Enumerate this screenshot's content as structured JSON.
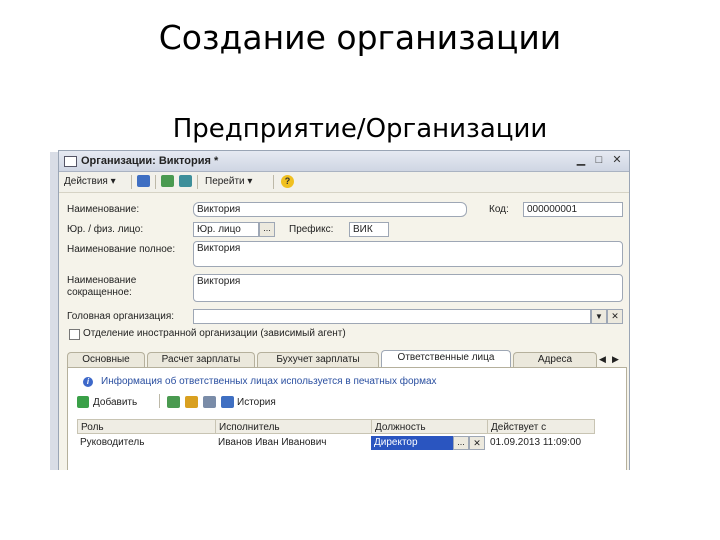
{
  "slide": {
    "title": "Создание организации",
    "subtitle": "Предприятие/Организации"
  },
  "window": {
    "title": "Организации: Виктория *",
    "minimize": "▁",
    "maximize": "□",
    "close": "✕"
  },
  "toolbar": {
    "actions_label": "Действия ▾",
    "goto_label": "Перейти ▾",
    "help_label": "?"
  },
  "form": {
    "name_label": "Наименование:",
    "name_value": "Виктория",
    "code_label": "Код:",
    "code_value": "000000001",
    "legal_label": "Юр. / физ. лицо:",
    "legal_value": "Юр. лицо",
    "prefix_label": "Префикс:",
    "prefix_value": "ВИК",
    "fullname_label": "Наименование полное:",
    "fullname_value": "Виктория",
    "shortname_label_1": "Наименование",
    "shortname_label_2": "сокращенное:",
    "shortname_value": "Виктория",
    "head_org_label": "Головная организация:",
    "head_org_value": "",
    "branch_label": "Отделение иностранной организации (зависимый агент)"
  },
  "tabs": [
    {
      "label": "Основные"
    },
    {
      "label": "Расчет зарплаты"
    },
    {
      "label": "Бухучет зарплаты"
    },
    {
      "label": "Ответственные лица"
    },
    {
      "label": "Адреса"
    }
  ],
  "tab_nav": {
    "prev": "◀",
    "next": "▶"
  },
  "responsible": {
    "info": "Информация об ответственных лицах используется в печатных формах",
    "add_label": "Добавить",
    "history_label": "История",
    "columns": [
      "Роль",
      "Исполнитель",
      "Должность",
      "Действует с"
    ],
    "rows": [
      {
        "role": "Руководитель",
        "person": "Иванов Иван Иванович",
        "position": "Директор",
        "since": "01.09.2013 11:09:00"
      }
    ]
  },
  "colors": {
    "selected_cell": "#2a55c0",
    "info_text": "#2a4fa0"
  },
  "icons": [
    "window-icon",
    "save-icon",
    "refresh-icon",
    "add-copy-icon",
    "help-icon",
    "add-icon",
    "copy-icon",
    "edit-icon",
    "delete-icon",
    "save-history-icon",
    "info-icon",
    "dropdown-icon",
    "clear-icon"
  ]
}
